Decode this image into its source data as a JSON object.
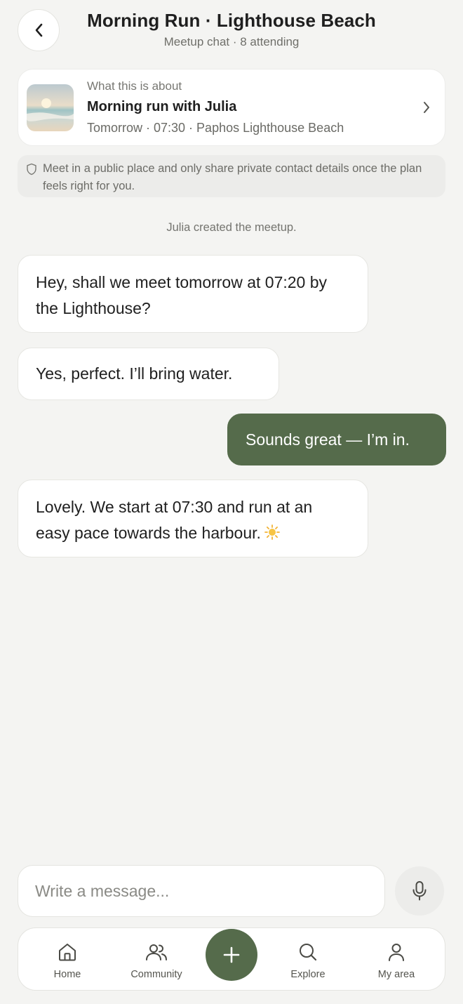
{
  "header": {
    "title": "Morning Run · Lighthouse Beach",
    "subtitle": "Meetup chat · 8 attending",
    "back_icon": "chevron-left-icon"
  },
  "context_card": {
    "label": "What this is about",
    "title": "Morning run with Julia",
    "meta": "Tomorrow · 07:30 · Paphos Lighthouse Beach",
    "thumbnail": "beach-photo",
    "chevron_icon": "chevron-right-icon"
  },
  "safety": {
    "icon": "shield-icon",
    "text": "Meet in a public place and only share private contact details once the plan feels right for you."
  },
  "system_message": "Julia created the meetup.",
  "messages": [
    {
      "direction": "in",
      "text": "Hey, shall we meet tomorrow at 07:20 by the Lighthouse?"
    },
    {
      "direction": "in",
      "text": "Yes, perfect. I’ll bring water."
    },
    {
      "direction": "out",
      "text": "Sounds great — I’m in."
    },
    {
      "direction": "in",
      "text": "Lovely. We start at 07:30 and run at an easy pace towards the harbour.",
      "emoji": "sun-icon"
    }
  ],
  "composer": {
    "placeholder": "Write a message...",
    "value": "",
    "mic_icon": "microphone-icon"
  },
  "nav": {
    "items": [
      {
        "label": "Home",
        "icon": "home-icon"
      },
      {
        "label": "Community",
        "icon": "community-icon"
      },
      {
        "label": "Explore",
        "icon": "search-icon"
      },
      {
        "label": "My area",
        "icon": "user-icon"
      }
    ],
    "fab_icon": "plus-icon"
  },
  "colors": {
    "accent": "#556b4b",
    "background": "#f4f4f2",
    "card": "#ffffff"
  }
}
